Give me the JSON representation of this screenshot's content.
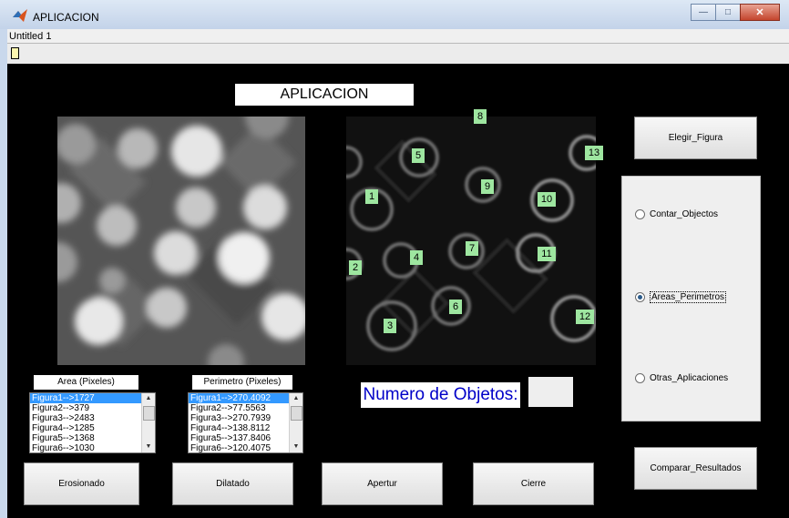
{
  "window": {
    "title": "APLICACION"
  },
  "menu": {
    "text": "Untitled 1"
  },
  "app": {
    "title": "APLICACION",
    "count_label": "Numero de Objetos:",
    "count_value": ""
  },
  "buttons": {
    "elegir": "Elegir_Figura",
    "comparar": "Comparar_Resultados",
    "erosionado": "Erosionado",
    "dilatado": "Dilatado",
    "apertur": "Apertur",
    "cierre": "Cierre"
  },
  "radios": [
    {
      "label": "Contar_Objectos",
      "selected": false
    },
    {
      "label": "Areas_Perimetros",
      "selected": true
    },
    {
      "label": "Otras_Aplicaciones",
      "selected": false
    }
  ],
  "area_list": {
    "header": "Area (Pixeles)",
    "items": [
      "Figura1-->1727",
      "Figura2-->379",
      "Figura3-->2483",
      "Figura4-->1285",
      "Figura5-->1368",
      "Figura6-->1030"
    ]
  },
  "perimetro_list": {
    "header": "Perimetro (Pixeles)",
    "items": [
      "Figura1-->270.4092",
      "Figura2-->77.5563",
      "Figura3-->270.7939",
      "Figura4-->138.8112",
      "Figura5-->137.8406",
      "Figura6-->120.4075"
    ]
  },
  "object_labels": [
    "1",
    "2",
    "3",
    "4",
    "5",
    "6",
    "7",
    "8",
    "9",
    "10",
    "11",
    "12",
    "13"
  ],
  "colors": {
    "canvas": "#000000",
    "label_bg": "#9ee6a0",
    "count_text": "#0000c8",
    "selected_row": "#3399ff"
  }
}
